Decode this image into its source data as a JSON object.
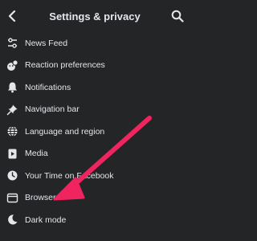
{
  "header": {
    "title": "Settings & privacy",
    "back_icon": "back-chevron-icon",
    "search_icon": "search-icon"
  },
  "menu": {
    "items": [
      {
        "label": "News Feed",
        "icon": "sliders-icon"
      },
      {
        "label": "Reaction preferences",
        "icon": "reaction-icon"
      },
      {
        "label": "Notifications",
        "icon": "bell-icon"
      },
      {
        "label": "Navigation bar",
        "icon": "pin-icon"
      },
      {
        "label": "Language and region",
        "icon": "globe-icon"
      },
      {
        "label": "Media",
        "icon": "media-icon"
      },
      {
        "label": "Your Time on Facebook",
        "icon": "clock-icon"
      },
      {
        "label": "Browser",
        "icon": "browser-icon"
      },
      {
        "label": "Dark mode",
        "icon": "moon-icon"
      }
    ]
  },
  "annotation": {
    "arrow_color": "#f0245f",
    "points_to": "Browser"
  },
  "colors": {
    "background": "#242526",
    "text": "#e4e6eb"
  }
}
